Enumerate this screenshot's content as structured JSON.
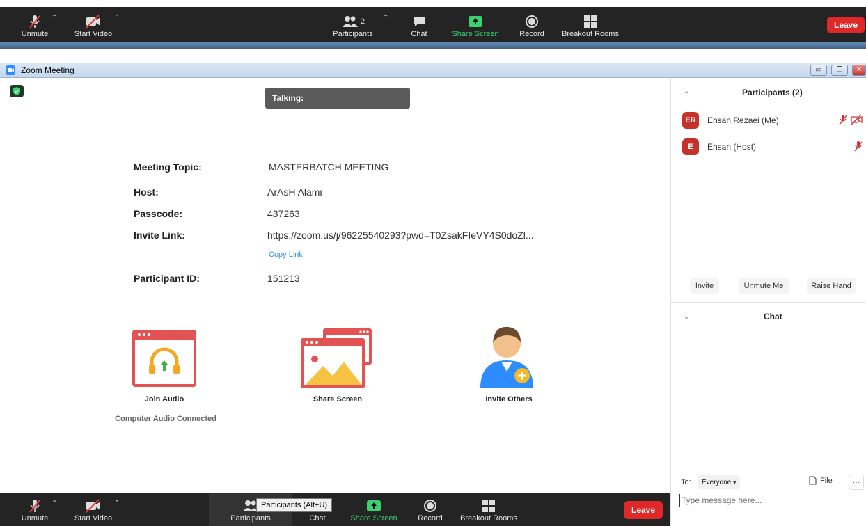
{
  "colors": {
    "toolbar_bg": "#242424",
    "leave_red": "#e02828",
    "share_green": "#3bd16f",
    "avatar_red": "#c4332b",
    "accent_blue": "#2d8cff"
  },
  "top_toolbar": {
    "unmute": "Unmute",
    "start_video": "Start Video",
    "participants": "Participants",
    "participants_count": "2",
    "chat": "Chat",
    "share_screen": "Share Screen",
    "record": "Record",
    "breakout_rooms": "Breakout Rooms",
    "leave": "Leave"
  },
  "window": {
    "title": "Zoom Meeting"
  },
  "talking_banner": "Talking:",
  "meeting_info": {
    "topic_label": "Meeting Topic:",
    "topic_value": "MASTERBATCH MEETING",
    "host_label": "Host:",
    "host_value": "ArAsH Alami",
    "passcode_label": "Passcode:",
    "passcode_value": "437263",
    "invite_label": "Invite Link:",
    "invite_value": "https://zoom.us/j/96225540293?pwd=T0ZsakFIeVY4S0doZl...",
    "copy_link": "Copy Link",
    "participant_id_label": "Participant ID:",
    "participant_id_value": "151213"
  },
  "actions": {
    "join_audio": "Join Audio",
    "audio_status": "Computer Audio Connected",
    "share_screen": "Share Screen",
    "invite_others": "Invite Others"
  },
  "participants_panel": {
    "title": "Participants (2)",
    "people": [
      {
        "initials": "ER",
        "name": "Ehsan Rezaei (Me)"
      },
      {
        "initials": "E",
        "name": "Ehsan (Host)"
      }
    ],
    "invite": "Invite",
    "unmute_me": "Unmute Me",
    "raise_hand": "Raise Hand"
  },
  "chat_panel": {
    "title": "Chat",
    "to_label": "To:",
    "recipient": "Everyone",
    "file": "File",
    "more": "···",
    "placeholder": "Type message here..."
  },
  "bottom_toolbar": {
    "unmute": "Unmute",
    "start_video": "Start Video",
    "participants": "Participants",
    "tooltip": "Participants (Alt+U)",
    "chat": "Chat",
    "share_screen": "Share Screen",
    "record": "Record",
    "breakout_rooms": "Breakout Rooms",
    "leave": "Leave"
  }
}
